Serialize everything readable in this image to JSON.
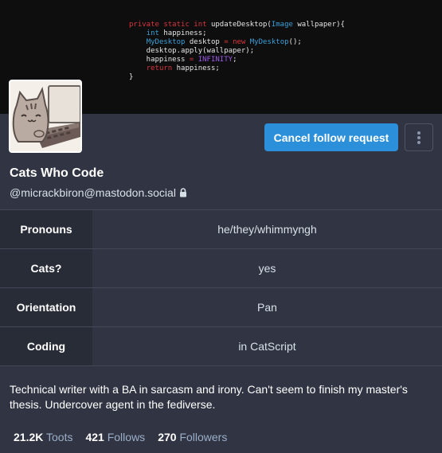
{
  "header": {
    "code_lines": [
      {
        "parts": [
          {
            "t": "private static int",
            "c": "kw"
          },
          {
            "t": " updateDesktop(",
            "c": ""
          },
          {
            "t": "Image",
            "c": "ty"
          },
          {
            "t": " wallpaper){",
            "c": ""
          }
        ]
      },
      {
        "parts": [
          {
            "t": "    ",
            "c": ""
          },
          {
            "t": "int",
            "c": "ty"
          },
          {
            "t": " happiness;",
            "c": ""
          }
        ]
      },
      {
        "parts": [
          {
            "t": "    ",
            "c": ""
          },
          {
            "t": "MyDesktop",
            "c": "ty"
          },
          {
            "t": " desktop ",
            "c": ""
          },
          {
            "t": "= new",
            "c": "kw"
          },
          {
            "t": " ",
            "c": ""
          },
          {
            "t": "MyDesktop",
            "c": "ty"
          },
          {
            "t": "();",
            "c": ""
          }
        ]
      },
      {
        "parts": [
          {
            "t": "    desktop.apply(wallpaper);",
            "c": ""
          }
        ]
      },
      {
        "parts": [
          {
            "t": "    happiness ",
            "c": ""
          },
          {
            "t": "=",
            "c": "kw"
          },
          {
            "t": " ",
            "c": ""
          },
          {
            "t": "INFINITY",
            "c": "cst"
          },
          {
            "t": ";",
            "c": ""
          }
        ]
      },
      {
        "parts": [
          {
            "t": "    ",
            "c": ""
          },
          {
            "t": "return",
            "c": "ret"
          },
          {
            "t": " happiness;",
            "c": ""
          }
        ]
      },
      {
        "parts": [
          {
            "t": "}",
            "c": ""
          }
        ]
      }
    ]
  },
  "actions": {
    "follow_label": "Cancel follow request"
  },
  "profile": {
    "display_name": "Cats Who Code",
    "handle": "@micrackbiron@mastodon.social"
  },
  "fields": [
    {
      "name": "Pronouns",
      "value": "he/they/whimmyngh"
    },
    {
      "name": "Cats?",
      "value": "yes"
    },
    {
      "name": "Orientation",
      "value": "Pan"
    },
    {
      "name": "Coding",
      "value": "in CatScript"
    }
  ],
  "bio": "Technical writer with a BA in sarcasm and irony. Can't seem to finish my master's thesis. Undercover agent in the fediverse.",
  "stats": {
    "toots_count": "21.2K",
    "toots_label": "Toots",
    "follows_count": "421",
    "follows_label": "Follows",
    "followers_count": "270",
    "followers_label": "Followers"
  },
  "colors": {
    "accent": "#2b90d9",
    "background": "#313543",
    "field_name_bg": "#282c37",
    "muted_text": "#9baec8"
  }
}
